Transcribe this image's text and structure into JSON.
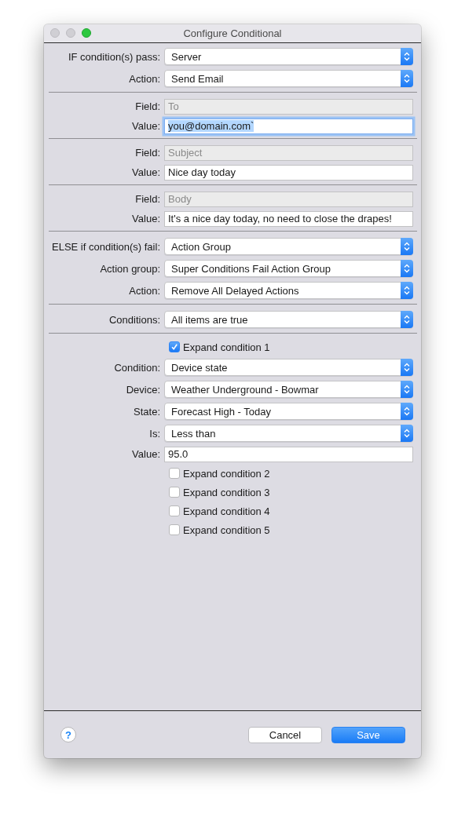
{
  "window": {
    "title": "Configure Conditional"
  },
  "rows": [
    {
      "kind": "popup",
      "label": "IF condition(s) pass:",
      "value": "Server"
    },
    {
      "kind": "popup",
      "label": "Action:",
      "value": "Send Email"
    },
    {
      "kind": "separator"
    },
    {
      "kind": "text",
      "label": "Field:",
      "value": "To",
      "disabled": true,
      "focused": false
    },
    {
      "kind": "text",
      "label": "Value:",
      "value": "you@domain.com`",
      "disabled": false,
      "focused": true
    },
    {
      "kind": "separator"
    },
    {
      "kind": "text",
      "label": "Field:",
      "value": "Subject",
      "disabled": true,
      "focused": false
    },
    {
      "kind": "text",
      "label": "Value:",
      "value": "Nice day today",
      "disabled": false,
      "focused": false
    },
    {
      "kind": "separator"
    },
    {
      "kind": "text",
      "label": "Field:",
      "value": "Body",
      "disabled": true,
      "focused": false
    },
    {
      "kind": "text",
      "label": "Value:",
      "value": "It's a nice day today, no need to close the drapes!",
      "disabled": false,
      "focused": false
    },
    {
      "kind": "separator"
    },
    {
      "kind": "popup",
      "label": "ELSE if condition(s) fail:",
      "value": "Action Group"
    },
    {
      "kind": "popup",
      "label": "Action group:",
      "value": "Super Conditions Fail Action Group"
    },
    {
      "kind": "popup",
      "label": "Action:",
      "value": "Remove All Delayed Actions"
    },
    {
      "kind": "separator"
    },
    {
      "kind": "popup",
      "label": "Conditions:",
      "value": "All items are true"
    },
    {
      "kind": "separator"
    },
    {
      "kind": "checkbox",
      "label": "Expand condition 1",
      "checked": true
    },
    {
      "kind": "popup",
      "label": "Condition:",
      "value": "Device state"
    },
    {
      "kind": "popup",
      "label": "Device:",
      "value": "Weather Underground - Bowmar"
    },
    {
      "kind": "popup",
      "label": "State:",
      "value": "Forecast High - Today"
    },
    {
      "kind": "popup",
      "label": "Is:",
      "value": "Less than"
    },
    {
      "kind": "text",
      "label": "Value:",
      "value": "95.0",
      "disabled": false,
      "focused": false
    },
    {
      "kind": "checkbox",
      "label": "Expand condition 2",
      "checked": false
    },
    {
      "kind": "checkbox",
      "label": "Expand condition 3",
      "checked": false
    },
    {
      "kind": "checkbox",
      "label": "Expand condition 4",
      "checked": false
    },
    {
      "kind": "checkbox",
      "label": "Expand condition 5",
      "checked": false
    }
  ],
  "footer": {
    "help": "?",
    "buttons": [
      {
        "label": "Cancel",
        "default": false
      },
      {
        "label": "Save",
        "default": true
      }
    ]
  }
}
